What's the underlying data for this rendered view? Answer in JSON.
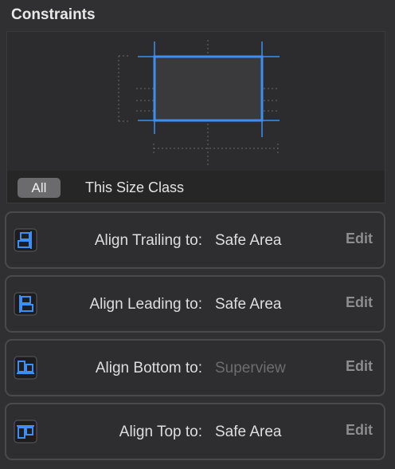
{
  "panel": {
    "title": "Constraints"
  },
  "filter": {
    "all_label": "All",
    "size_class_label": "This Size Class"
  },
  "constraints": [
    {
      "label": "Align Trailing to:",
      "target": "Safe Area",
      "edit": "Edit",
      "icon": "align-trailing-icon"
    },
    {
      "label": "Align Leading to:",
      "target": "Safe Area",
      "edit": "Edit",
      "icon": "align-leading-icon"
    },
    {
      "label": "Align Bottom to:",
      "target": "Superview",
      "edit": "Edit",
      "icon": "align-bottom-icon"
    },
    {
      "label": "Align Top to:",
      "target": "Safe Area",
      "edit": "Edit",
      "icon": "align-top-icon"
    }
  ],
  "colors": {
    "accent": "#3d8ef0"
  }
}
